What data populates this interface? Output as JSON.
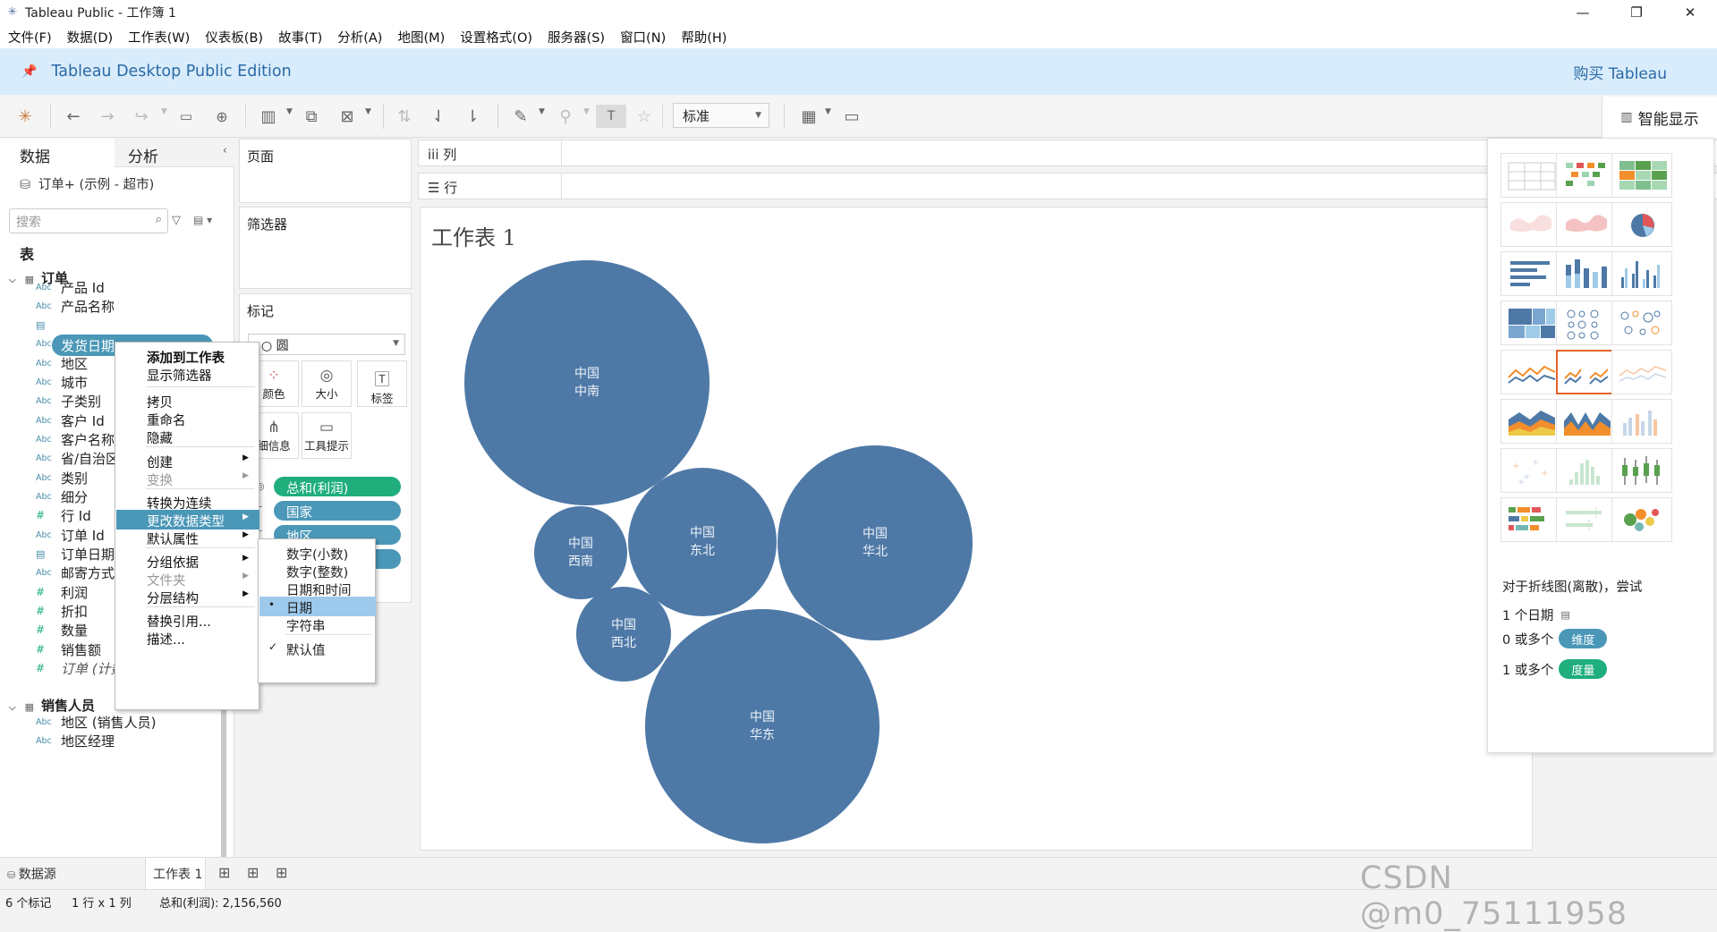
{
  "window": {
    "title": "Tableau Public - 工作簿 1",
    "minimize": "—",
    "restore": "❐",
    "close": "✕"
  },
  "menu": [
    "文件(F)",
    "数据(D)",
    "工作表(W)",
    "仪表板(B)",
    "故事(T)",
    "分析(A)",
    "地图(M)",
    "设置格式(O)",
    "服务器(S)",
    "窗口(N)",
    "帮助(H)"
  ],
  "banner": {
    "edition": "Tableau Desktop Public Edition",
    "buy": "购买 Tableau"
  },
  "toolbar": {
    "fit": "标准",
    "show_me": "智能显示"
  },
  "data_pane": {
    "tab_data": "数据",
    "tab_analysis": "分析",
    "datasource": "订单+ (示例 - 超市)",
    "search_placeholder": "搜索",
    "tables_label": "表",
    "group_orders": "订单",
    "fields": [
      {
        "type": "Abc",
        "name": "产品 Id"
      },
      {
        "type": "Abc",
        "name": "产品名称"
      },
      {
        "type": "cal",
        "name": "发货日期"
      },
      {
        "type": "Abc",
        "name": "国家"
      },
      {
        "type": "Abc",
        "name": "地区"
      },
      {
        "type": "Abc",
        "name": "城市"
      },
      {
        "type": "Abc",
        "name": "子类别"
      },
      {
        "type": "Abc",
        "name": "客户 Id"
      },
      {
        "type": "Abc",
        "name": "客户名称"
      },
      {
        "type": "Abc",
        "name": "省/自治区"
      },
      {
        "type": "Abc",
        "name": "类别"
      },
      {
        "type": "Abc",
        "name": "细分"
      },
      {
        "type": "#",
        "name": "行 Id"
      },
      {
        "type": "Abc",
        "name": "订单 Id"
      },
      {
        "type": "cal",
        "name": "订单日期"
      },
      {
        "type": "Abc",
        "name": "邮寄方式"
      },
      {
        "type": "#",
        "name": "利润"
      },
      {
        "type": "#",
        "name": "折扣"
      },
      {
        "type": "#",
        "name": "数量"
      },
      {
        "type": "#",
        "name": "销售额"
      },
      {
        "type": "#",
        "name": "订单 (计数)"
      }
    ],
    "selected_pill": "发货日期",
    "group_sales": "销售人员",
    "sales_fields": [
      {
        "type": "Abc",
        "name": "地区 (销售人员)"
      },
      {
        "type": "Abc",
        "name": "地区经理"
      }
    ]
  },
  "cards": {
    "pages": "页面",
    "filters": "筛选器",
    "marks": "标记",
    "mark_type": "圆",
    "buttons": {
      "color": "颜色",
      "size": "大小",
      "label": "标签",
      "detail": "细信息",
      "tooltip": "工具提示"
    },
    "pills": [
      "总和(利润)",
      "国家",
      "地区",
      ""
    ]
  },
  "shelves": {
    "columns": "列",
    "rows": "行"
  },
  "sheet_title": "工作表 1",
  "bubbles": [
    {
      "country": "中国",
      "region": "中南"
    },
    {
      "country": "中国",
      "region": "西南"
    },
    {
      "country": "中国",
      "region": "东北"
    },
    {
      "country": "中国",
      "region": "华北"
    },
    {
      "country": "中国",
      "region": "西北"
    },
    {
      "country": "中国",
      "region": "华东"
    }
  ],
  "context_menu": [
    "添加到工作表",
    "显示筛选器",
    "拷贝",
    "重命名",
    "隐藏",
    "创建",
    "变换",
    "转换为连续",
    "更改数据类型",
    "默认属性",
    "分组依据",
    "文件夹",
    "分层结构",
    "替换引用...",
    "描述..."
  ],
  "submenu": [
    "数字(小数)",
    "数字(整数)",
    "日期和时间",
    "日期",
    "字符串",
    "默认值"
  ],
  "show_me": {
    "hint": "对于折线图(离散)，尝试",
    "req1": "1 个日期",
    "req2": "0 或多个",
    "req2_pill": "维度",
    "req3": "1 或多个",
    "req3_pill": "度量"
  },
  "bottom": {
    "datasource_tab": "数据源",
    "sheet_tab": "工作表 1"
  },
  "status": {
    "marks": "6 个标记",
    "rows_cols": "1 行 x 1 列",
    "sum": "总和(利润): 2,156,560"
  },
  "watermark": "CSDN @m0_75111958",
  "colors": {
    "bubble": "#4e79a7",
    "dimension_pill": "#4a97b7",
    "measure_pill": "#1fae7c",
    "banner": "#d9ecfb"
  }
}
